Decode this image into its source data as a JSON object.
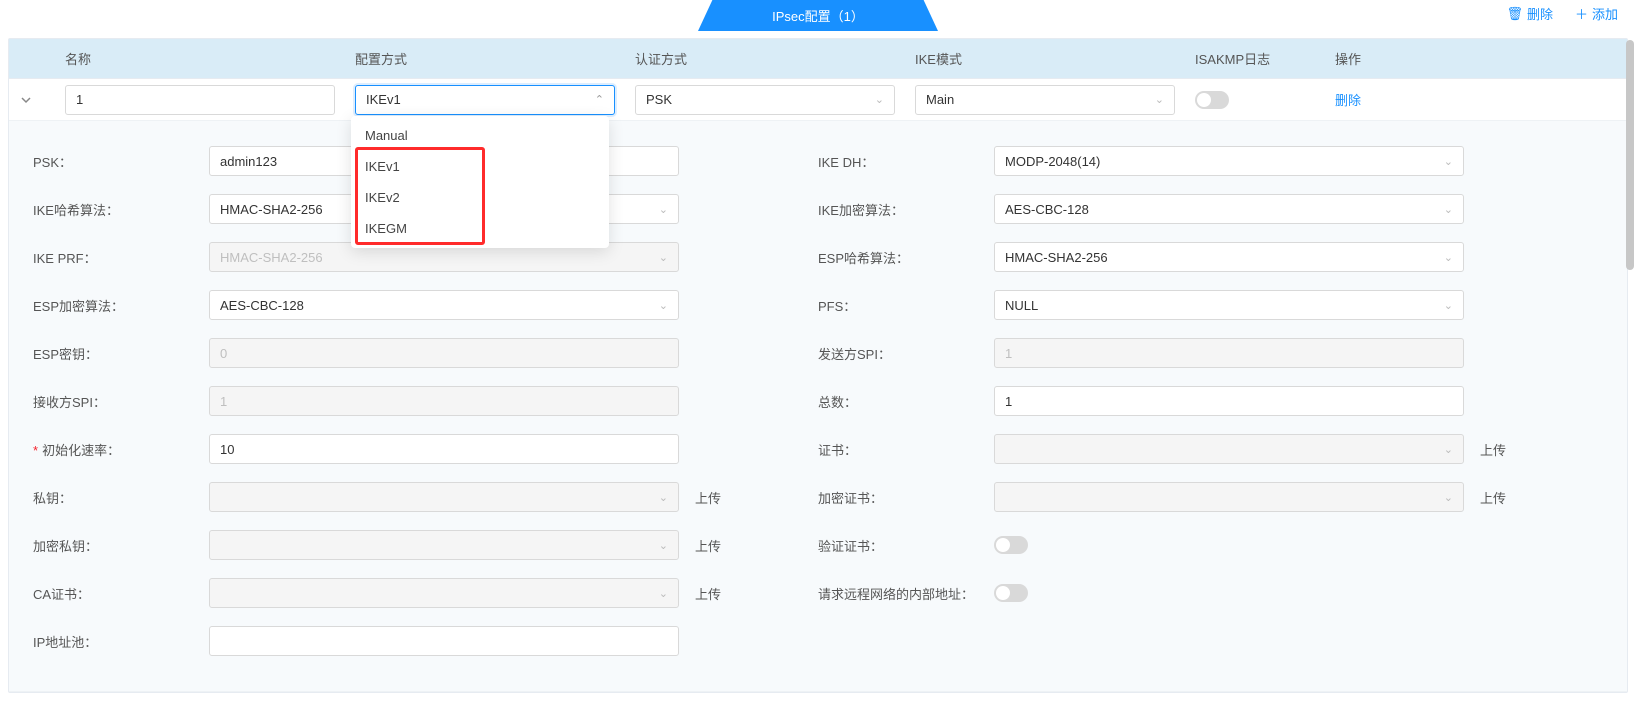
{
  "topbar": {
    "tab_title": "IPsec配置（1）",
    "delete_label": "删除",
    "add_label": "添加"
  },
  "table": {
    "headers": {
      "name": "名称",
      "config_mode": "配置方式",
      "auth_mode": "认证方式",
      "ike_mode": "IKE模式",
      "isakmp_log": "ISAKMP日志",
      "operation": "操作"
    },
    "row": {
      "name": "1",
      "config_mode": "IKEv1",
      "auth_mode": "PSK",
      "ike_mode": "Main",
      "op_delete": "删除"
    }
  },
  "dropdown": {
    "options": [
      "Manual",
      "IKEv1",
      "IKEv2",
      "IKEGM"
    ]
  },
  "detail": {
    "left": {
      "psk_label": "PSK：",
      "psk_value": "admin123",
      "ike_hash_label": "IKE哈希算法：",
      "ike_hash_value": "HMAC-SHA2-256",
      "ike_prf_label": "IKE PRF：",
      "ike_prf_value": "HMAC-SHA2-256",
      "esp_enc_label": "ESP加密算法：",
      "esp_enc_value": "AES-CBC-128",
      "esp_key_label": "ESP密钥：",
      "esp_key_value": "0",
      "recv_spi_label": "接收方SPI：",
      "recv_spi_value": "1",
      "init_rate_label": "初始化速率：",
      "init_rate_value": "10",
      "priv_key_label": "私钥：",
      "priv_key_value": "",
      "enc_priv_key_label": "加密私钥：",
      "enc_priv_key_value": "",
      "ca_cert_label": "CA证书：",
      "ca_cert_value": "",
      "ip_pool_label": "IP地址池："
    },
    "right": {
      "ike_dh_label": "IKE DH：",
      "ike_dh_value": "MODP-2048(14)",
      "ike_enc_label": "IKE加密算法：",
      "ike_enc_value": "AES-CBC-128",
      "esp_hash_label": "ESP哈希算法：",
      "esp_hash_value": "HMAC-SHA2-256",
      "pfs_label": "PFS：",
      "pfs_value": "NULL",
      "send_spi_label": "发送方SPI：",
      "send_spi_value": "1",
      "total_label": "总数：",
      "total_value": "1",
      "cert_label": "证书：",
      "cert_value": "",
      "enc_cert_label": "加密证书：",
      "enc_cert_value": "",
      "verify_cert_label": "验证证书：",
      "req_remote_label": "请求远程网络的内部地址："
    },
    "upload_label": "上传"
  }
}
